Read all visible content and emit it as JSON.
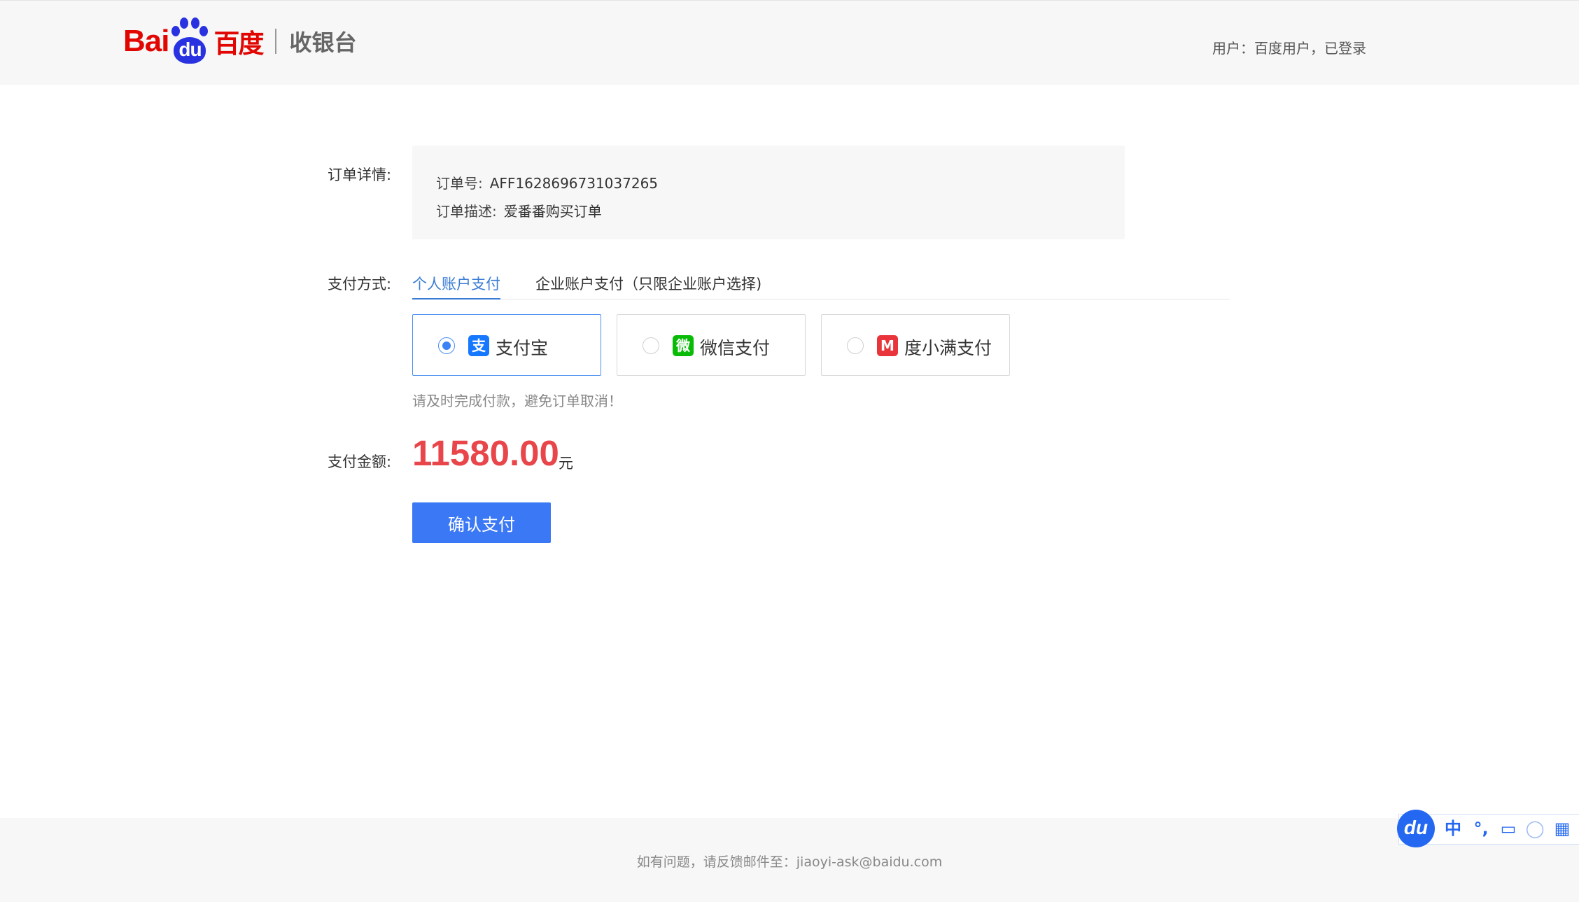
{
  "header": {
    "logo_text_bai": "Ba",
    "logo_text_i": "i",
    "logo_text_du": "du",
    "logo_text_cn": "百度",
    "subtitle": "收银台",
    "user_status": "用户：百度用户，已登录"
  },
  "order": {
    "label": "订单详情:",
    "number_label": "订单号:",
    "number_value": "AFF1628696731037265",
    "desc_label": "订单描述:",
    "desc_value": "爱番番购买订单"
  },
  "payment": {
    "label": "支付方式:",
    "tabs": [
      {
        "label": "个人账户支付",
        "active": true
      },
      {
        "label": "企业账户支付（只限企业账户选择)",
        "active": false
      }
    ],
    "options": [
      {
        "label": "支付宝",
        "icon": "alipay-icon",
        "color": "#1677ff",
        "glyph": "支",
        "selected": true
      },
      {
        "label": "微信支付",
        "icon": "wechat-pay-icon",
        "color": "#09bb07",
        "glyph": "微",
        "selected": false
      },
      {
        "label": "度小满支付",
        "icon": "duxiaoman-icon",
        "color": "#e8343a",
        "glyph": "M",
        "selected": false
      }
    ],
    "hint": "请及时完成付款，避免订单取消！"
  },
  "amount": {
    "label": "支付金额:",
    "value": "11580.00",
    "unit": "元"
  },
  "confirm_label": "确认支付",
  "footer": {
    "text": "如有问题，请反馈邮件至：jiaoyi-ask@baidu.com"
  },
  "ime": {
    "logo": "du",
    "buttons": [
      "中",
      "°,",
      "▭",
      "◯",
      "▦"
    ]
  },
  "colors": {
    "accent": "#3b78f5",
    "amount": "#e8464a",
    "brand_red": "#e10602",
    "brand_blue": "#2932e1"
  }
}
